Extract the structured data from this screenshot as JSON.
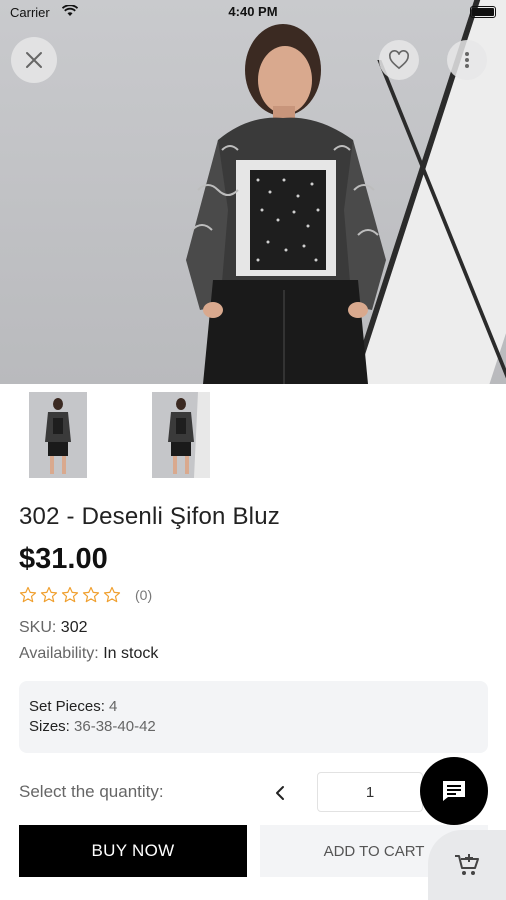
{
  "status_bar": {
    "carrier": "Carrier",
    "time": "4:40 PM"
  },
  "product": {
    "title": "302 - Desenli Şifon Bluz",
    "price": "$31.00",
    "rating_count": "(0)",
    "sku_label": "SKU:",
    "sku_value": "302",
    "availability_label": "Availability:",
    "availability_value": "In stock",
    "rating": 0
  },
  "details": {
    "set_pieces_label": "Set Pieces:",
    "set_pieces_value": "4",
    "sizes_label": "Sizes:",
    "sizes_value": "36-38-40-42"
  },
  "quantity": {
    "label": "Select the quantity:",
    "value": "1"
  },
  "actions": {
    "buy_now": "BUY NOW",
    "add_to_cart": "ADD TO CART"
  },
  "icons": {
    "close": "close-icon",
    "favorite": "heart-icon",
    "more": "more-vertical-icon",
    "chat": "chat-icon",
    "cart": "add-to-cart-icon",
    "star": "star-outline-icon"
  },
  "colors": {
    "accent": "#000000",
    "star": "#f0a030"
  }
}
